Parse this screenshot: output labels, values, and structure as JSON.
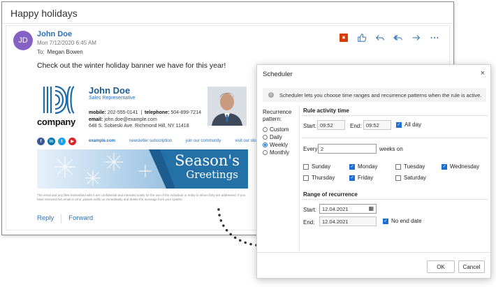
{
  "email": {
    "window_title": "Happy holidays",
    "avatar_initials": "JD",
    "sender": "John Doe",
    "date": "Mon 7/12/2020 6:45 AM",
    "to_label": "To:",
    "to_name": "Megan Bowen",
    "body": "Check out the winter holiday banner we have for this year!",
    "toolbar_icons": [
      "office-icon",
      "like-icon",
      "reply-icon",
      "reply-all-icon",
      "forward-icon",
      "more-icon"
    ],
    "reply_label": "Reply",
    "forward_label": "Forward"
  },
  "signature": {
    "company": "company",
    "name": "John Doe",
    "role": "Sales Representative",
    "mobile_label": "mobile:",
    "mobile": "202-555-0141",
    "telephone_label": "telephone:",
    "telephone": "504-899-7214",
    "email_label": "email:",
    "email": "john.doe@example.com",
    "address": "648 S. Sobieski Ave. Richmond Hill, NY 11418",
    "links": [
      "example.com",
      "newsletter subscription",
      "join our community",
      "visit our store"
    ],
    "social_icons": [
      "facebook-icon",
      "linkedin-icon",
      "twitter-icon",
      "youtube-icon"
    ],
    "banner_line1": "Season's",
    "banner_line2": "Greetings",
    "disclaimer": "The email and any files transmitted with it are confidential and intended solely for the use of the individual or entity to whom they are addressed. If you have received this email in error, please notify us immediately and delete the message from your system."
  },
  "scheduler": {
    "title": "Scheduler",
    "close": "×",
    "info": "Scheduler lets you choose time ranges and recurrence patterns when the rule is active.",
    "recurrence_label": "Recurrence pattern:",
    "patterns": [
      "Custom",
      "Daily",
      "Weekly",
      "Monthly"
    ],
    "selected_pattern": "Weekly",
    "rule_activity_time": "Rule activity time",
    "start_label": "Start:",
    "start_time": "09:52",
    "end_label": "End:",
    "end_time": "09:52",
    "all_day_label": "All day",
    "all_day": true,
    "every_label": "Every",
    "every_value": "2",
    "weeks_on_label": "weeks on",
    "days": [
      {
        "label": "Sunday",
        "checked": false
      },
      {
        "label": "Monday",
        "checked": true
      },
      {
        "label": "Tuesday",
        "checked": false
      },
      {
        "label": "Wednesday",
        "checked": true
      },
      {
        "label": "Thursday",
        "checked": false
      },
      {
        "label": "Friday",
        "checked": true
      },
      {
        "label": "Saturday",
        "checked": false
      }
    ],
    "range_title": "Range of recurrence",
    "range_start_label": "Start:",
    "range_start": "12.04.2021",
    "range_end_label": "End:",
    "range_end": "12.04.2021",
    "no_end_date_label": "No end date",
    "no_end_date": true,
    "ok_label": "OK",
    "cancel_label": "Cancel",
    "accent": "#1a6fd0"
  }
}
